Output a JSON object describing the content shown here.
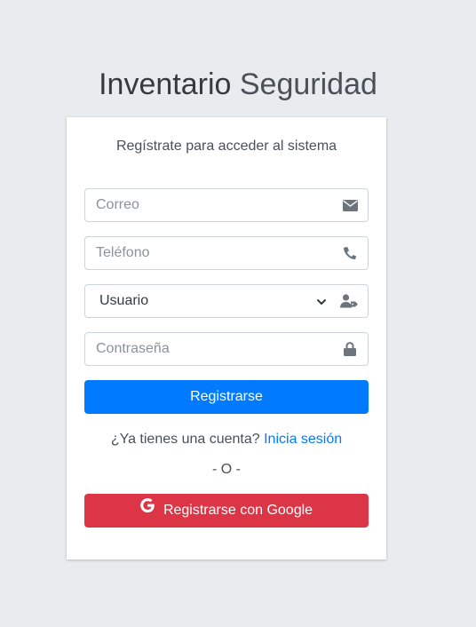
{
  "brand": {
    "bold": "Inventario",
    "light": "Seguridad"
  },
  "card": {
    "subtitle": "Regístrate para acceder al sistema",
    "email": {
      "placeholder": "Correo",
      "icon": "envelope-icon"
    },
    "phone": {
      "placeholder": "Teléfono",
      "icon": "phone-icon"
    },
    "role": {
      "value": "Usuario",
      "icon": "user-tag-icon"
    },
    "password": {
      "placeholder": "Contraseña",
      "icon": "lock-icon"
    },
    "register_button": "Registrarse",
    "login_prompt": "¿Ya tienes una cuenta?",
    "login_link": "Inicia sesión",
    "separator": "- O -",
    "google_button": "Registrarse con Google"
  },
  "colors": {
    "background": "#e9ecef",
    "primary": "#007bff",
    "danger": "#dc3545",
    "icon": "#6c757d"
  }
}
